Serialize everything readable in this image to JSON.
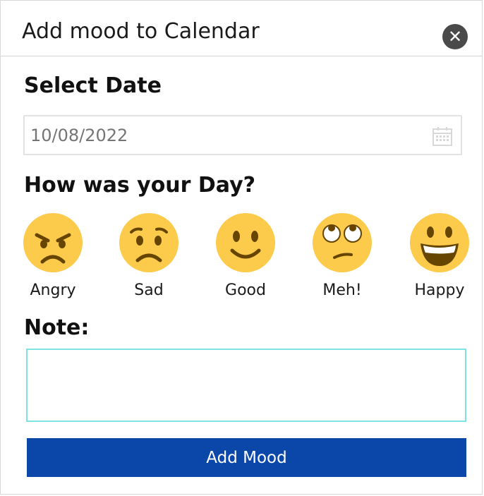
{
  "dialog": {
    "title": "Add mood to Calendar",
    "close_icon": "close-icon"
  },
  "date": {
    "label": "Select Date",
    "placeholder": "10/08/2022",
    "icon": "calendar-icon"
  },
  "mood_section": {
    "label": "How was your Day?",
    "options": [
      {
        "label": "Angry",
        "icon": "angry-face-icon"
      },
      {
        "label": "Sad",
        "icon": "sad-face-icon"
      },
      {
        "label": "Good",
        "icon": "smiling-face-icon"
      },
      {
        "label": "Meh!",
        "icon": "eye-roll-face-icon"
      },
      {
        "label": "Happy",
        "icon": "grinning-face-icon"
      }
    ]
  },
  "note": {
    "label": "Note:",
    "value": ""
  },
  "submit": {
    "label": "Add Mood"
  },
  "colors": {
    "primary": "#0a47a9",
    "emoji_face": "#fccb4c",
    "emoji_feature": "#664500",
    "note_border": "#7fe3e3"
  }
}
